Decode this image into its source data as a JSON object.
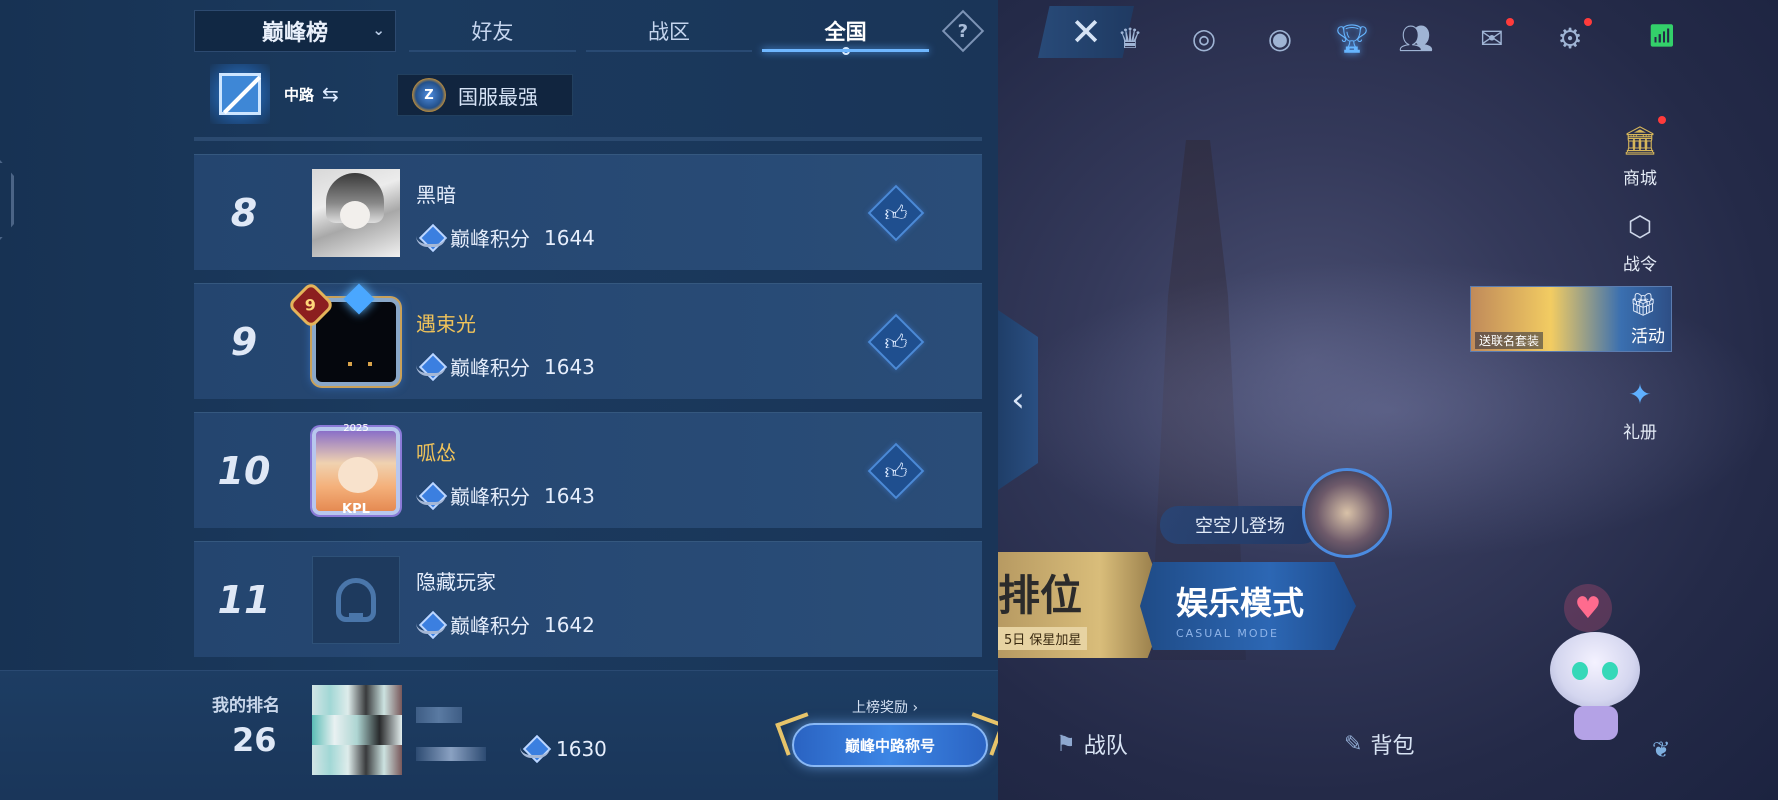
{
  "leaderboard": {
    "type_selector": "巅峰榜",
    "tabs": [
      {
        "label": "好友",
        "active": false
      },
      {
        "label": "战区",
        "active": false
      },
      {
        "label": "全国",
        "active": true
      }
    ],
    "help_symbol": "?",
    "lane": "中路",
    "region": "国服最强",
    "rows": [
      {
        "rank": "8",
        "name": "黑暗",
        "name_style": "normal",
        "score_label": "巅峰积分",
        "score": "1644",
        "avatar": "plain-photo"
      },
      {
        "rank": "9",
        "name": "遇束光",
        "name_style": "gold",
        "score_label": "巅峰积分",
        "score": "1643",
        "avatar": "gold-frame",
        "level_badge": "9"
      },
      {
        "rank": "10",
        "name": "呱怂",
        "name_style": "gold",
        "score_label": "巅峰积分",
        "score": "1643",
        "avatar": "kpl-frame",
        "frame_text": "KPL",
        "frame_year": "2025"
      },
      {
        "rank": "11",
        "name": "隐藏玩家",
        "name_style": "normal",
        "score_label": "巅峰积分",
        "score": "1642",
        "avatar": "hidden-player"
      }
    ],
    "my_rank": {
      "label": "我的排名",
      "value": "26",
      "score": "1630",
      "reward_link": "上榜奖励",
      "title_badge": "巅峰中路称号"
    }
  },
  "game_lobby": {
    "close_symbol": "✕",
    "top_icons": [
      "crown-icon",
      "target-icon",
      "eye-icon",
      "trophy-icon",
      "friends-icon",
      "mail-icon",
      "settings-icon"
    ],
    "side_menu": [
      {
        "label": "商城",
        "icon": "shop-icon"
      },
      {
        "label": "战令",
        "icon": "battlepass-icon"
      },
      {
        "label": "礼册",
        "icon": "gift-book-icon"
      }
    ],
    "event_banner": {
      "caption": "送联名套装",
      "label": "活动"
    },
    "hero_announce": "空空儿登场",
    "mode_rank": {
      "title": "排位",
      "subtitle": "5日 保星加星"
    },
    "mode_fun": {
      "title": "娱乐模式",
      "subtitle": "CASUAL MODE"
    },
    "bottom_nav": [
      {
        "label": "战队",
        "icon": "team-icon"
      },
      {
        "label": "背包",
        "icon": "bag-icon"
      }
    ],
    "collapse_symbol": "‹"
  },
  "colors": {
    "accent": "#6fb7ff",
    "gold_name": "#f0c35a",
    "row_bg": "#24456f"
  }
}
